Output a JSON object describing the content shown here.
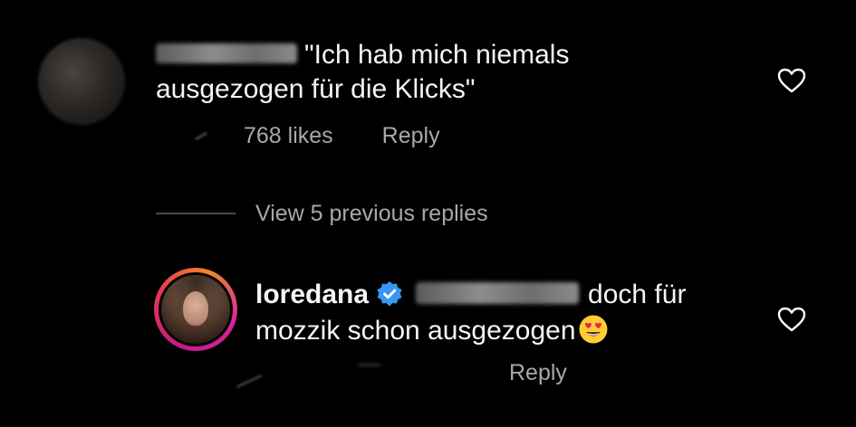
{
  "comments": [
    {
      "username_blurred": true,
      "text": "\"Ich hab mich niemals ausgezogen für die Klicks\"",
      "likes": "768 likes",
      "reply_label": "Reply",
      "like_icon": "heart-outline-icon"
    }
  ],
  "view_previous": {
    "label": "View 5 previous replies"
  },
  "reply": {
    "username": "loredana",
    "verified_icon": "verified-badge-icon",
    "mention_blurred": true,
    "text_line1": "doch für",
    "text_line2": "mozzik schon ausgezogen",
    "emoji": "heart-eyes-emoji",
    "reply_label": "Reply",
    "like_icon": "heart-outline-icon"
  },
  "colors": {
    "background": "#000000",
    "text": "#f5f5f5",
    "secondary_text": "#a8a8a8",
    "verified_blue": "#3897f0",
    "story_ring": [
      "#c21a8a",
      "#e4335b",
      "#f58529"
    ]
  }
}
